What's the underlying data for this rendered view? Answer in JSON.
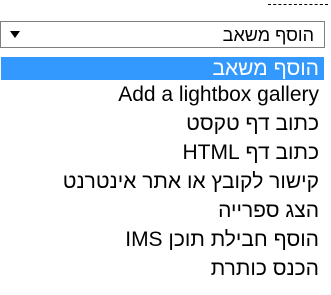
{
  "select": {
    "selected_value": "הוסף משאב",
    "caret_icon": "triangle-down-icon"
  },
  "options": [
    {
      "label": "הוסף משאב",
      "highlighted": true
    },
    {
      "label": "Add a lightbox gallery"
    },
    {
      "label": "כתוב דף טקסט"
    },
    {
      "label": "כתוב דף HTML"
    },
    {
      "label": "קישור לקובץ או אתר אינטרנט"
    },
    {
      "label": "הצג ספרייה"
    },
    {
      "label": "הוסף חבילת תוכן IMS"
    },
    {
      "label": "הכנס כותרת"
    }
  ],
  "colors": {
    "highlight": "#3399ff",
    "highlight_text": "#ffffff",
    "border": "#7f7f7f"
  }
}
